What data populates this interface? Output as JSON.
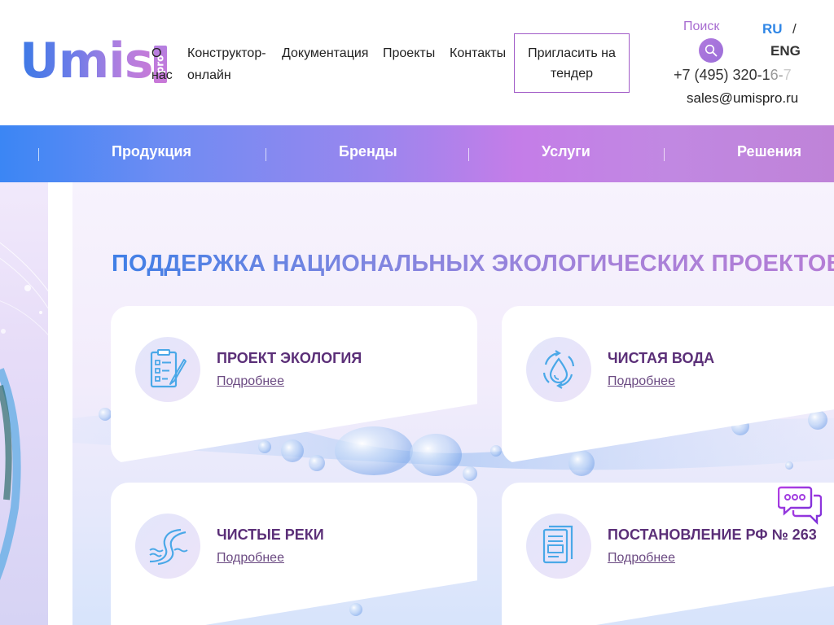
{
  "header": {
    "logo": {
      "main": "Umis",
      "badge": "pro"
    },
    "nav": [
      {
        "label_line1": "О",
        "label_line2": "нас"
      },
      {
        "label_line1": "Конструктор-",
        "label_line2": "онлайн"
      },
      {
        "label": "Документация"
      },
      {
        "label": "Проекты"
      },
      {
        "label": "Контакты"
      }
    ],
    "tender_button": "Пригласить на тендер",
    "search_label": "Поиск",
    "lang": {
      "ru": "RU",
      "separator": "/",
      "eng": "ENG"
    },
    "phone": {
      "visible": "+7 (495) 320-1",
      "fade": "6-",
      "fade2": "7"
    },
    "email": "sales@umispro.ru"
  },
  "category_bar": {
    "items": [
      "Продукция",
      "Бренды",
      "Услуги",
      "Решения"
    ]
  },
  "main": {
    "title": "ПОДДЕРЖКА НАЦИОНАЛЬНЫХ ЭКОЛОГИЧЕСКИХ ПРОЕКТОВ",
    "cards": [
      {
        "title": "ПРОЕКТ ЭКОЛОГИЯ",
        "link": "Подробнее",
        "icon": "checklist-icon"
      },
      {
        "title": "ЧИСТАЯ ВОДА",
        "link": "Подробнее",
        "icon": "water-drop-icon"
      },
      {
        "title": "ЧИСТЫЕ РЕКИ",
        "link": "Подробнее",
        "icon": "river-icon"
      },
      {
        "title": "ПОСТАНОВЛЕНИЕ РФ № 263",
        "link": "Подробнее",
        "icon": "document-icon"
      }
    ]
  },
  "colors": {
    "brand_blue": "#3b86f4",
    "brand_purple": "#c47de8",
    "card_title": "#5b2f78",
    "icon_blue": "#4aa8e8"
  }
}
